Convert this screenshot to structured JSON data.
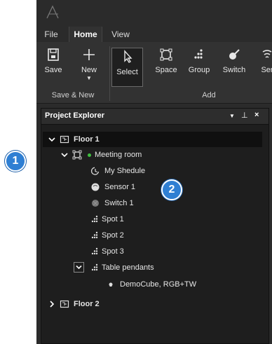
{
  "callouts": [
    "1",
    "2"
  ],
  "menu_tabs": [
    "File",
    "Home",
    "View"
  ],
  "ribbon": {
    "buttons": [
      {
        "label": "Save",
        "icon": "save-icon"
      },
      {
        "label": "New",
        "icon": "plus-icon"
      },
      {
        "label": "Select",
        "icon": "cursor-icon"
      },
      {
        "label": "Space",
        "icon": "space-icon"
      },
      {
        "label": "Group",
        "icon": "group-icon"
      },
      {
        "label": "Switch",
        "icon": "switch-icon"
      },
      {
        "label": "Ser",
        "icon": "sensor-icon"
      }
    ],
    "groups": [
      "Save & New",
      "Add"
    ]
  },
  "panel": {
    "title": "Project Explorer",
    "controls": [
      "▼",
      "⊥",
      "×"
    ]
  },
  "tree": [
    {
      "label": "Floor 1",
      "icon": "floor-icon",
      "expanded": true
    },
    {
      "label": "Meeting room",
      "icon": "room-icon",
      "status_color": "#3fbf3f",
      "expanded": true
    },
    {
      "label": "My Shedule",
      "icon": "schedule-icon"
    },
    {
      "label": "Sensor 1",
      "icon": "sensor-icon"
    },
    {
      "label": "Switch 1",
      "icon": "switch-icon"
    },
    {
      "label": "Spot 1",
      "icon": "spot-icon"
    },
    {
      "label": "Spot 2",
      "icon": "spot-icon"
    },
    {
      "label": "Spot 3",
      "icon": "spot-icon"
    },
    {
      "label": "Table pendants",
      "icon": "spot-icon",
      "expanded": true
    },
    {
      "label": "DemoCube, RGB+TW",
      "icon": "bulb-icon"
    },
    {
      "label": "Floor 2",
      "icon": "floor-icon",
      "expanded": false
    }
  ],
  "colors": {
    "callout": "#2f7fd3",
    "status_green": "#3fbf3f",
    "panel_bg": "#1e1e1e",
    "app_bg": "#2b2b2b"
  }
}
